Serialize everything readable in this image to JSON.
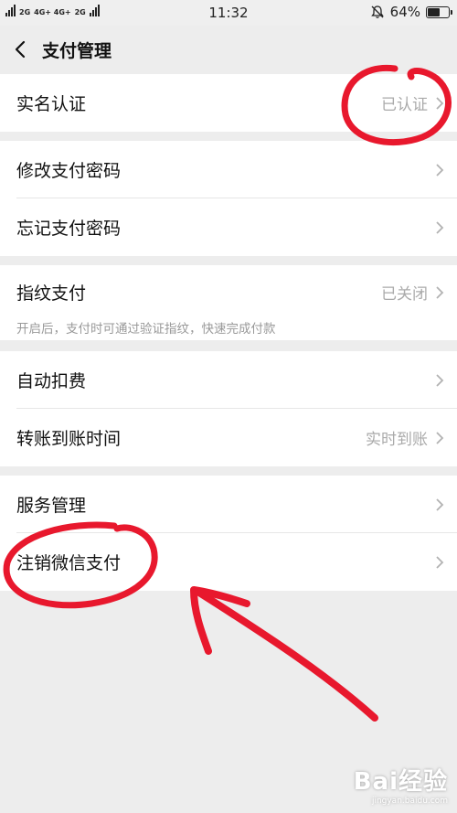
{
  "status_bar": {
    "network_labels": [
      "2G",
      "4G+ 4G+",
      "2G"
    ],
    "time": "11:32",
    "battery": "64%",
    "battery_level": 0.64
  },
  "header": {
    "title": "支付管理"
  },
  "groups": [
    {
      "rows": [
        {
          "label": "实名认证",
          "value": "已认证"
        }
      ]
    },
    {
      "rows": [
        {
          "label": "修改支付密码",
          "value": ""
        },
        {
          "label": "忘记支付密码",
          "value": ""
        }
      ]
    },
    {
      "rows": [
        {
          "label": "指纹支付",
          "value": "已关闭",
          "description": "开启后，支付时可通过验证指纹，快速完成付款"
        }
      ]
    },
    {
      "rows": [
        {
          "label": "自动扣费",
          "value": ""
        },
        {
          "label": "转账到账时间",
          "value": "实时到账"
        }
      ]
    },
    {
      "rows": [
        {
          "label": "服务管理",
          "value": ""
        },
        {
          "label": "注销微信支付",
          "value": ""
        }
      ]
    }
  ],
  "colors": {
    "background": "#ededed",
    "annotation": "#e8182d",
    "secondary_text": "#aaaaaa"
  },
  "watermark": {
    "logo": "Bai经验",
    "url": "jingyan.baidu.com"
  }
}
